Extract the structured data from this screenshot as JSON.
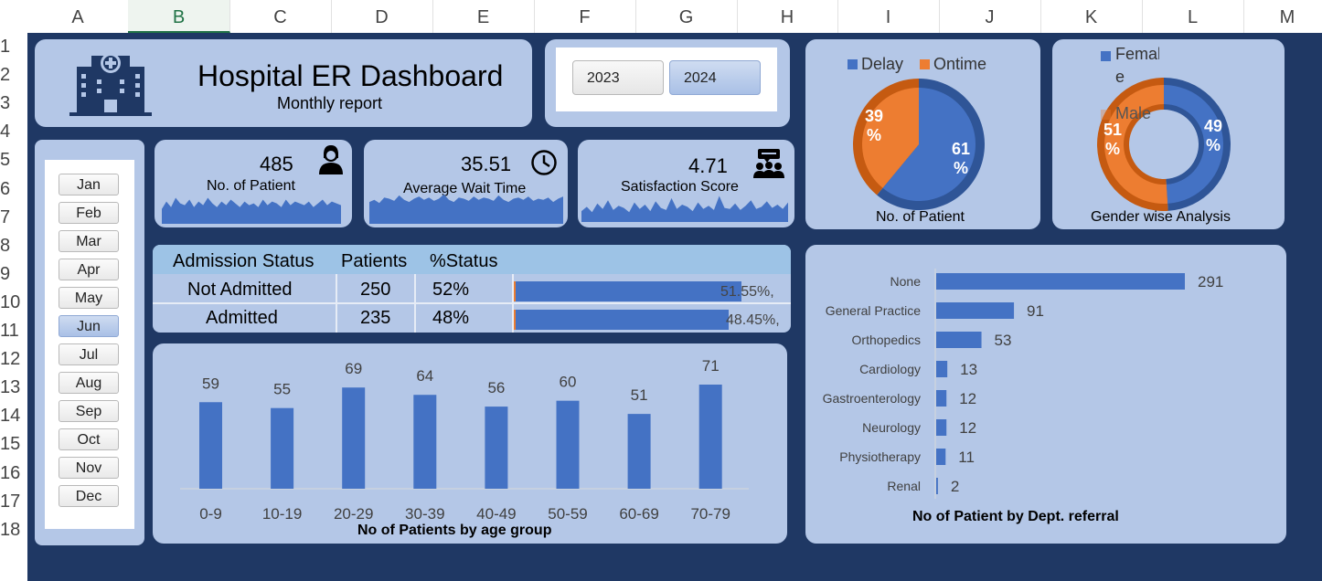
{
  "sheet": {
    "columns": [
      "A",
      "B",
      "C",
      "D",
      "E",
      "F",
      "G",
      "H",
      "I",
      "J",
      "K",
      "L",
      "M"
    ],
    "selected_column": "B",
    "rows": [
      "1",
      "2",
      "3",
      "4",
      "5",
      "6",
      "7",
      "8",
      "9",
      "10",
      "11",
      "12",
      "13",
      "14",
      "15",
      "16",
      "17",
      "18"
    ]
  },
  "header": {
    "title": "Hospital ER Dashboard",
    "subtitle": "Monthly report"
  },
  "years": {
    "y2023": "2023",
    "y2024": "2024",
    "selected": "2024"
  },
  "months": [
    "Jan",
    "Feb",
    "Mar",
    "Apr",
    "May",
    "Jun",
    "Jul",
    "Aug",
    "Sep",
    "Oct",
    "Nov",
    "Dec"
  ],
  "selected_month": "Jun",
  "kpis": {
    "patients": {
      "value": "485",
      "label": "No. of Patient"
    },
    "wait": {
      "value": "35.51",
      "label": "Average Wait Time"
    },
    "satisfaction": {
      "value": "4.71",
      "label": "Satisfaction Score"
    }
  },
  "admission": {
    "headers": {
      "status": "Admission Status",
      "patients": "Patients",
      "pct": "%Status"
    },
    "rows": [
      {
        "status": "Not Admitted",
        "patients": "250",
        "pct": "52%",
        "bar_label": "51.55%,",
        "fraction": 0.5155
      },
      {
        "status": "Admitted",
        "patients": "235",
        "pct": "48%",
        "bar_label": "48.45%,",
        "fraction": 0.4845
      }
    ]
  },
  "punctuality_pie": {
    "legend": {
      "delay": "Delay",
      "ontime": "Ontime"
    },
    "delay_label": "61 %",
    "ontime_label": "39 %",
    "title": "No. of Patient"
  },
  "gender_donut": {
    "legend": {
      "female": "Female",
      "male": "Male"
    },
    "female_label": "49 %",
    "male_label": "51 %",
    "title": "Gender wise Analysis"
  },
  "age_chart_title": "No of Patients by age group",
  "dept_chart_title": "No of Patient by Dept. referral",
  "colors": {
    "navy": "#1f3864",
    "card": "#b4c7e7",
    "blue": "#4472c4",
    "orange": "#ed7d31"
  },
  "chart_data": [
    {
      "type": "pie",
      "categories": [
        "Delay",
        "Ontime"
      ],
      "values": [
        61,
        39
      ],
      "title": "No. of Patient"
    },
    {
      "type": "pie",
      "categories": [
        "Female",
        "Male"
      ],
      "values": [
        49,
        51
      ],
      "title": "Gender wise Analysis"
    },
    {
      "type": "bar",
      "categories": [
        "0-9",
        "10-19",
        "20-29",
        "30-39",
        "40-49",
        "50-59",
        "60-69",
        "70-79"
      ],
      "values": [
        59,
        55,
        69,
        64,
        56,
        60,
        51,
        71
      ],
      "title": "No of Patients by age group",
      "ylim": [
        0,
        80
      ]
    },
    {
      "type": "bar",
      "orientation": "horizontal",
      "categories": [
        "None",
        "General Practice",
        "Orthopedics",
        "Cardiology",
        "Gastroenterology",
        "Neurology",
        "Physiotherapy",
        "Renal"
      ],
      "values": [
        291,
        91,
        53,
        13,
        12,
        12,
        11,
        2
      ],
      "title": "No of Patient by Dept. referral"
    },
    {
      "type": "area",
      "title": "",
      "values": [
        8,
        12,
        9,
        14,
        11,
        10,
        13,
        9,
        12,
        10,
        14,
        11,
        9,
        12,
        10,
        13,
        11,
        9,
        12,
        10,
        11,
        9,
        13,
        10,
        12,
        11,
        9,
        13,
        10,
        12,
        11,
        10,
        12,
        9,
        11,
        13,
        10,
        12,
        11,
        10
      ]
    },
    {
      "type": "area",
      "title": "",
      "values": [
        20,
        22,
        19,
        24,
        23,
        21,
        26,
        22,
        20,
        23,
        25,
        22,
        24,
        21,
        23,
        27,
        22,
        20,
        24,
        23,
        21,
        25,
        22,
        24,
        23,
        21,
        26,
        22,
        20,
        23,
        24,
        22,
        25,
        21,
        23,
        22,
        24,
        20,
        23,
        25
      ]
    },
    {
      "type": "area",
      "title": "",
      "values": [
        10,
        14,
        9,
        17,
        12,
        20,
        11,
        15,
        13,
        9,
        18,
        12,
        16,
        10,
        19,
        13,
        11,
        22,
        12,
        16,
        14,
        10,
        18,
        12,
        15,
        11,
        24,
        13,
        12,
        17,
        11,
        15,
        20,
        12,
        14,
        19,
        13,
        16,
        12,
        18
      ]
    }
  ]
}
